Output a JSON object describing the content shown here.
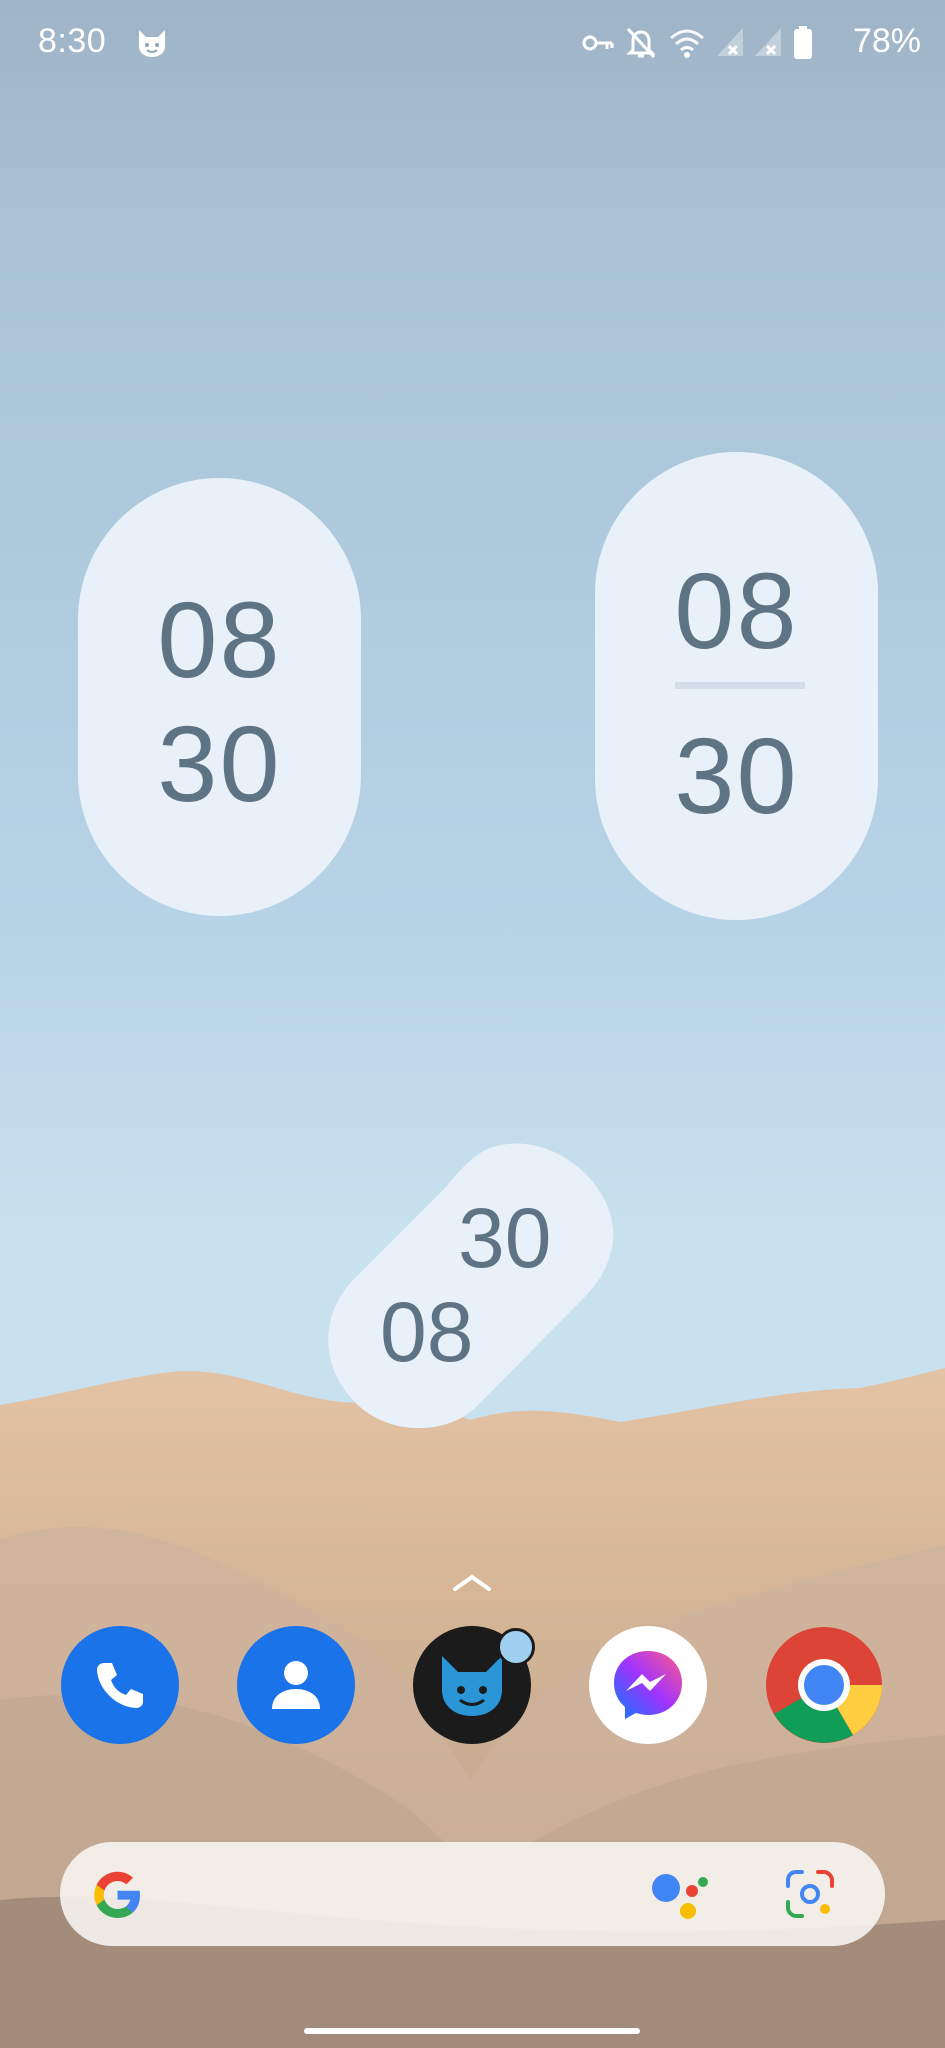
{
  "status_bar": {
    "time": "8:30",
    "battery_percent": "78%",
    "icons": [
      "cat-notification-icon",
      "vpn-key-icon",
      "notifications-off-icon",
      "wifi-icon",
      "signal-no-data-icon",
      "signal-no-data-icon",
      "battery-icon"
    ]
  },
  "clock_widgets": {
    "stacked": {
      "hour": "08",
      "minute": "30"
    },
    "divided": {
      "hour": "08",
      "minute": "30"
    },
    "diagonal": {
      "hour": "08",
      "minute": "30"
    }
  },
  "dock": {
    "apps": [
      {
        "name": "Phone",
        "icon": "phone-icon",
        "color": "#1a73e8"
      },
      {
        "name": "Contacts",
        "icon": "contacts-icon",
        "color": "#1a73e8"
      },
      {
        "name": "Cat app",
        "icon": "cat-icon",
        "color": "#1b1b1b",
        "has_notification": true
      },
      {
        "name": "Messenger",
        "icon": "messenger-icon",
        "color": "#ffffff"
      },
      {
        "name": "Chrome",
        "icon": "chrome-icon",
        "color": "#4285f4"
      }
    ]
  },
  "search_bar": {
    "icons": [
      "google-g-icon",
      "google-assistant-icon",
      "google-lens-icon"
    ]
  },
  "colors": {
    "clock_text": "#5e7384",
    "clock_bg": "#e8f1f9",
    "sky_top": "#9fb6c8",
    "sand": "#d9b99b"
  }
}
